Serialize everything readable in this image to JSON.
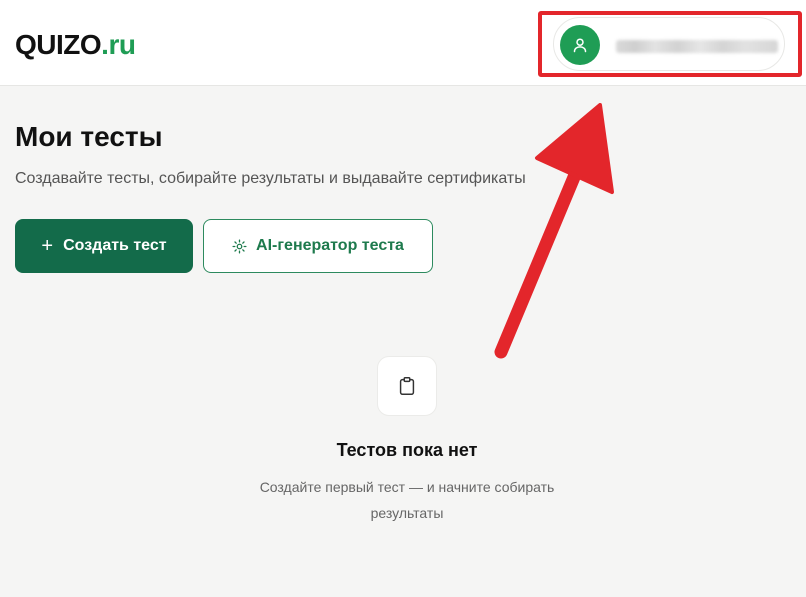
{
  "header": {
    "logo": {
      "brand": "QUIZO",
      "tld": ".ru"
    },
    "user": {
      "avatar_icon": "user-icon",
      "name": ""
    }
  },
  "main": {
    "title": "Мои тесты",
    "subtitle": "Создавайте тесты, собирайте результаты и выдавайте сертификаты",
    "actions": {
      "create": {
        "icon": "plus-icon",
        "label": "Создать тест"
      },
      "ai_generator": {
        "icon": "sparkle-icon",
        "label": "AI-генератор теста"
      }
    },
    "empty_state": {
      "icon": "clipboard-icon",
      "title": "Тестов пока нет",
      "description": "Создайте первый тест — и начните собирать результаты"
    }
  },
  "colors": {
    "brand_green": "#1f9d55",
    "primary_button": "#136b4a",
    "annotation_red": "#e3262b"
  }
}
